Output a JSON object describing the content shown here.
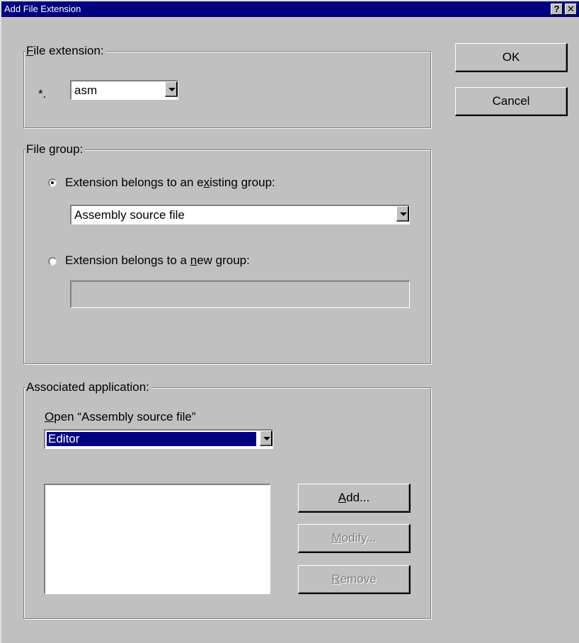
{
  "window": {
    "title": "Add File Extension",
    "help_glyph": "?",
    "close_glyph": "✕"
  },
  "file_extension": {
    "group_label_hotkey": "F",
    "group_label_rest": "ile extension:",
    "prefix": "*.",
    "value": "asm"
  },
  "file_group": {
    "group_label": "File group:",
    "existing_option": {
      "label_before": "Extension belongs to an e",
      "label_hotkey": "x",
      "label_after": "isting group:",
      "selected": true
    },
    "existing_value": "Assembly source file",
    "new_option": {
      "label_before": "Extension belongs to a ",
      "label_hotkey": "n",
      "label_after": "ew group:",
      "selected": false
    },
    "new_value": ""
  },
  "associated_application": {
    "group_label": "Associated application:",
    "open_label_hotkey": "O",
    "open_label_rest": "pen “Assembly source file”",
    "app_value": "Editor",
    "add_hotkey": "A",
    "add_rest": "dd...",
    "modify_hotkey": "M",
    "modify_rest": "odify...",
    "remove_hotkey": "R",
    "remove_rest": "emove"
  },
  "buttons": {
    "ok": "OK",
    "cancel": "Cancel"
  },
  "colors": {
    "titlebar": "#000080",
    "face": "#c0c0c0",
    "selection": "#000080"
  }
}
